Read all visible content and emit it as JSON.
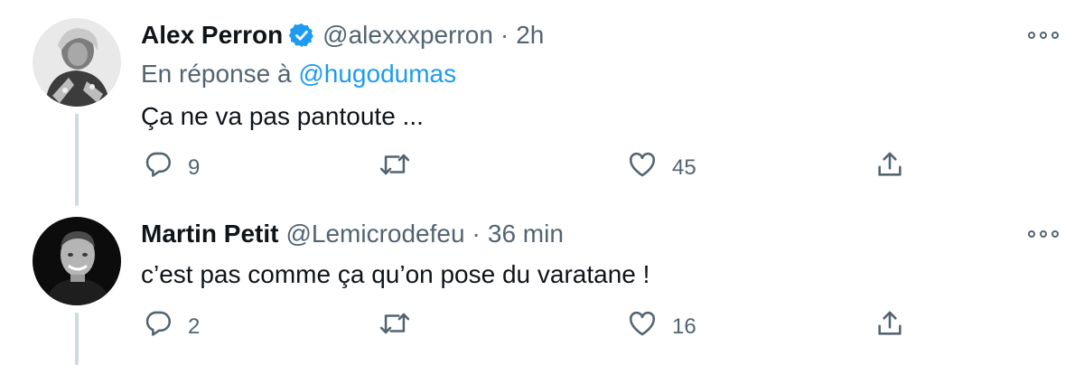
{
  "tweets": [
    {
      "name": "Alex Perron",
      "verified": true,
      "handle": "@alexxxperron",
      "separator": "·",
      "time": "2h",
      "reply_prefix": "En réponse à",
      "reply_mention": "@hugodumas",
      "text": "Ça ne va pas pantoute ...",
      "replies": "9",
      "retweets": "",
      "likes": "45"
    },
    {
      "name": "Martin Petit",
      "verified": false,
      "handle": "@Lemicrodefeu",
      "separator": "·",
      "time": "36 min",
      "text": "c’est pas comme ça qu’on pose du varatane !",
      "replies": "2",
      "retweets": "",
      "likes": "16"
    }
  ],
  "colors": {
    "text": "#0f1419",
    "secondary": "#536471",
    "accent": "#1d9bf0",
    "thread_line": "#cfd9de"
  },
  "icons": [
    "more-icon",
    "verified-icon",
    "reply-icon",
    "retweet-icon",
    "like-icon",
    "share-icon"
  ]
}
